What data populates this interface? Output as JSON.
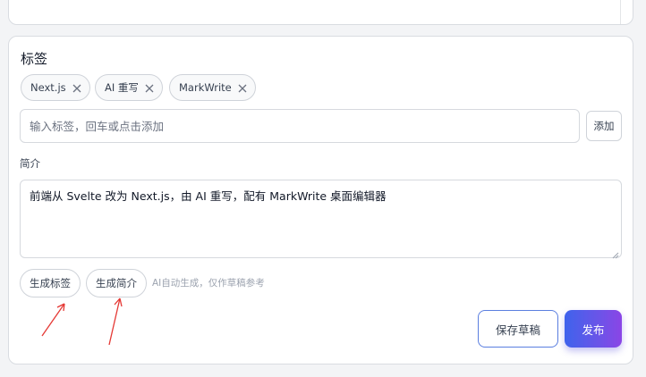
{
  "tags_section": {
    "title": "标签",
    "chips": [
      {
        "label": "Next.js"
      },
      {
        "label": "AI 重写"
      },
      {
        "label": "MarkWrite"
      }
    ],
    "input_placeholder": "输入标签，回车或点击添加",
    "add_label": "添加"
  },
  "intro_section": {
    "label": "简介",
    "text": "前端从 Svelte 改为 Next.js，由 AI 重写，配有 MarkWrite 桌面编辑器"
  },
  "generate": {
    "tags_label": "生成标签",
    "intro_label": "生成简介",
    "hint": "AI自动生成，仅作草稿参考"
  },
  "actions": {
    "save_draft_label": "保存草稿",
    "publish_label": "发布"
  },
  "colors": {
    "annotation_arrow": "#e53935",
    "publish_gradient_start": "#3f63ec",
    "publish_gradient_end": "#8b45e6",
    "draft_border": "#5b7fe0"
  }
}
